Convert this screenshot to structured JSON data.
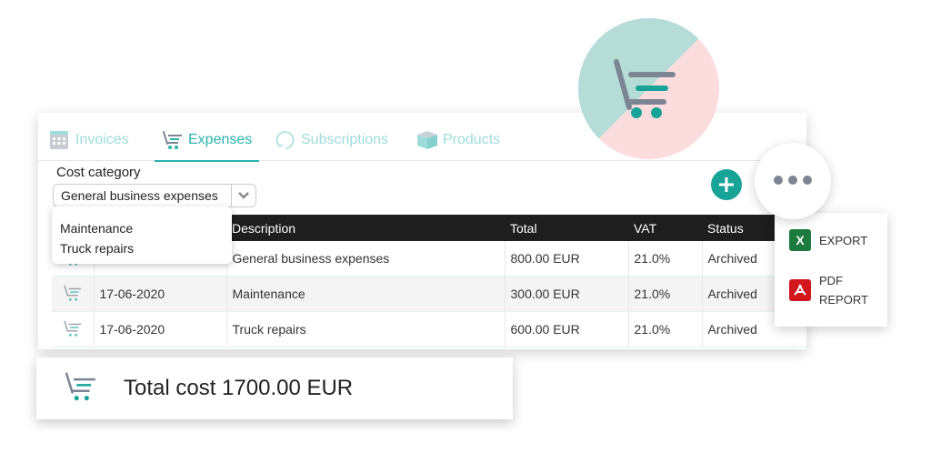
{
  "tabs": [
    {
      "label": "Invoices",
      "icon": "calculator-icon",
      "active": false
    },
    {
      "label": "Expenses",
      "icon": "cart-icon",
      "active": true
    },
    {
      "label": "Subscriptions",
      "icon": "refresh-icon",
      "active": false
    },
    {
      "label": "Products",
      "icon": "box-icon",
      "active": false
    }
  ],
  "filter": {
    "label": "Cost category",
    "selected": "General business expenses",
    "options": [
      "Maintenance",
      "Truck repairs"
    ]
  },
  "table": {
    "columns": [
      "",
      "",
      "Description",
      "Total",
      "VAT",
      "Status"
    ],
    "rows": [
      {
        "date": "",
        "description": "General business expenses",
        "total": "800.00 EUR",
        "vat": "21.0%",
        "status": "Archived"
      },
      {
        "date": "17-06-2020",
        "description": "Maintenance",
        "total": "300.00 EUR",
        "vat": "21.0%",
        "status": "Archived"
      },
      {
        "date": "17-06-2020",
        "description": "Truck repairs",
        "total": "600.00 EUR",
        "vat": "21.0%",
        "status": "Archived"
      }
    ]
  },
  "total": {
    "text": "Total cost 1700.00 EUR"
  },
  "menu": {
    "export_label": "EXPORT",
    "pdf_label_line1": "PDF",
    "pdf_label_line2": "REPORT"
  },
  "colors": {
    "accent": "#2bb3ad",
    "add_button": "#17a398",
    "excel": "#1d7a3e",
    "pdf": "#d3161c"
  }
}
